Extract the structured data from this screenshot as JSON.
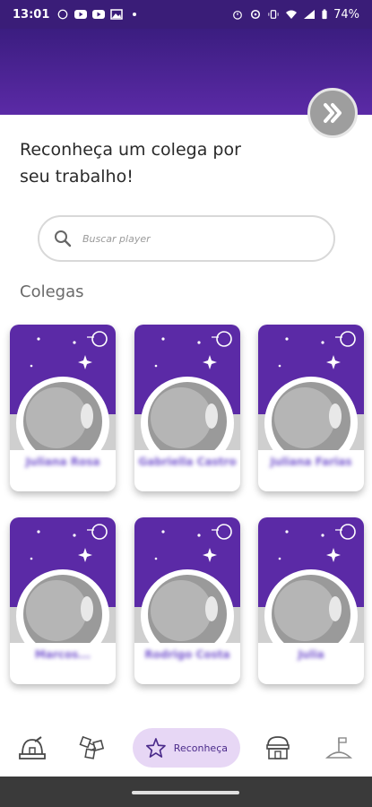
{
  "status_bar": {
    "time": "13:01",
    "battery": "74%"
  },
  "header": {
    "next_icon": "double-chevron-right-icon"
  },
  "heading": {
    "line1": "Reconheça um colega por",
    "line2": "seu trabalho!"
  },
  "search": {
    "placeholder": "Buscar player",
    "icon": "search-icon"
  },
  "section_title": "Colegas",
  "cards": [
    {
      "name": "Juliana Rosa"
    },
    {
      "name": "Gabriella Castro"
    },
    {
      "name": "Juliana Farias"
    },
    {
      "name": "Marcos..."
    },
    {
      "name": "Rodrigo Costa"
    },
    {
      "name": "Julia"
    }
  ],
  "nav": {
    "items": [
      {
        "icon": "observatory-icon"
      },
      {
        "icon": "satellites-icon"
      },
      {
        "icon": "star-icon",
        "label": "Reconheça"
      },
      {
        "icon": "store-icon"
      },
      {
        "icon": "moon-flag-icon"
      }
    ]
  },
  "colors": {
    "purple": "#5b2aa6",
    "purple_dark": "#3b1d80",
    "active_pill": "#e7d7f5",
    "grey_button": "#9e9e9e"
  }
}
